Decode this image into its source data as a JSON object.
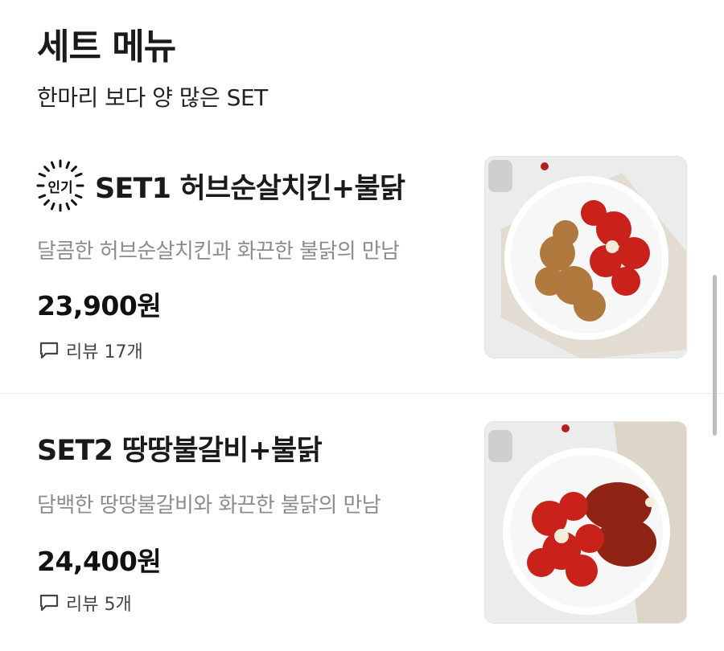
{
  "section": {
    "title": "세트 메뉴",
    "subtitle": "한마리 보다 양 많은 SET"
  },
  "items": [
    {
      "badge": "인기",
      "name": "SET1 허브순살치킨+불닭",
      "description": "달콤한 허브순살치킨과 화끈한 불닭의 만남",
      "price": "23,900원",
      "review_label": "리뷰 17개",
      "image_icon": "food-photo"
    },
    {
      "name": "SET2 땅땅불갈비+불닭",
      "description": "담백한 땅땅불갈비와 화끈한 불닭의 만남",
      "price": "24,400원",
      "review_label": "리뷰 5개",
      "image_icon": "food-photo"
    }
  ],
  "colors": {
    "badge_ring": "#111111",
    "description": "#8c8c8c",
    "divider": "#ececec"
  }
}
